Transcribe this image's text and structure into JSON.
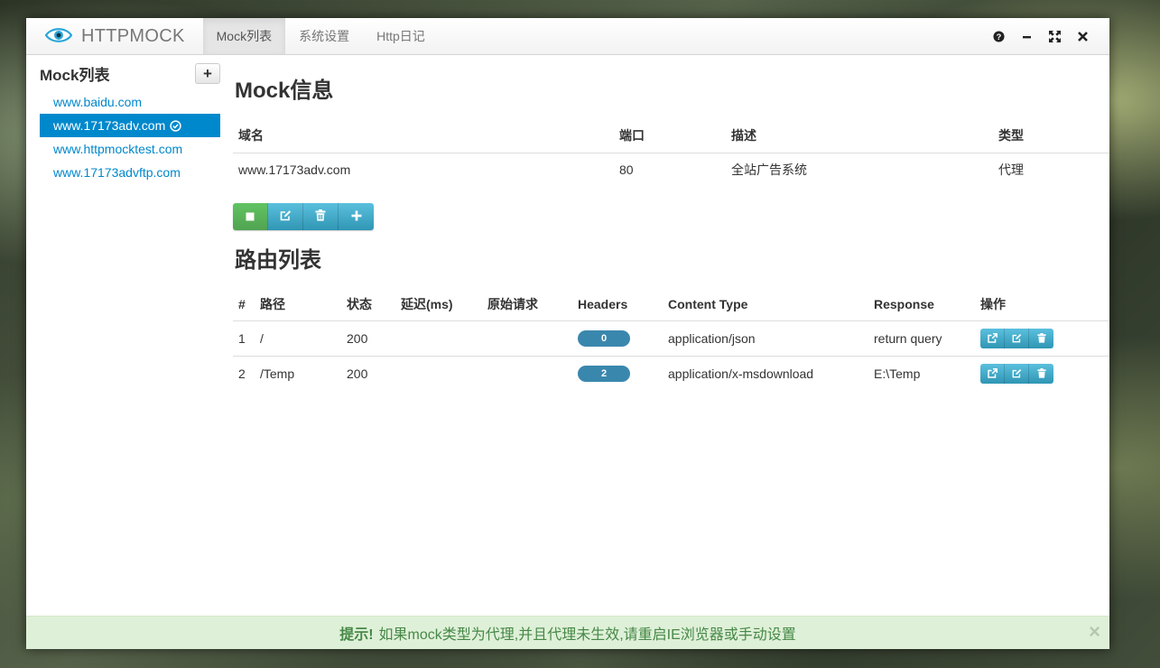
{
  "app": {
    "title": "HTTPMOCK",
    "tabs": [
      "Mock列表",
      "系统设置",
      "Http日记"
    ]
  },
  "sidebar": {
    "title": "Mock列表",
    "add_label": "+",
    "items": [
      {
        "label": "www.baidu.com",
        "active": false
      },
      {
        "label": "www.17173adv.com",
        "active": true
      },
      {
        "label": "www.httpmocktest.com",
        "active": false
      },
      {
        "label": "www.17173advftp.com",
        "active": false
      }
    ]
  },
  "mock_info": {
    "title": "Mock信息",
    "headers": [
      "域名",
      "端口",
      "描述",
      "类型"
    ],
    "row": [
      "www.17173adv.com",
      "80",
      "全站广告系统",
      "代理"
    ]
  },
  "routes": {
    "title": "路由列表",
    "headers": [
      "#",
      "路径",
      "状态",
      "延迟(ms)",
      "原始请求",
      "Headers",
      "Content Type",
      "Response",
      "操作"
    ],
    "rows": [
      {
        "num": "1",
        "path": "/",
        "status": "200",
        "delay": "",
        "raw": "",
        "headers": "0",
        "content_type": "application/json",
        "response": "return query"
      },
      {
        "num": "2",
        "path": "/Temp",
        "status": "200",
        "delay": "",
        "raw": "",
        "headers": "2",
        "content_type": "application/x-msdownload",
        "response": "E:\\Temp"
      }
    ]
  },
  "alert": {
    "strong": "提示!",
    "message": "如果mock类型为代理,并且代理未生效,请重启IE浏览器或手动设置",
    "close": "×"
  },
  "colors": {
    "link": "#0088cc",
    "active_bg": "#0088cc",
    "success_btn": "#51a351",
    "info_btn": "#2f96b4",
    "badge": "#3a87ad",
    "alert_bg": "#dff0d8",
    "alert_text": "#468847"
  },
  "icons": [
    "eye-icon",
    "help-icon",
    "minimize-icon",
    "fullscreen-icon",
    "close-icon",
    "check-circle-icon",
    "stop-icon",
    "edit-icon",
    "trash-icon",
    "plus-icon",
    "share-icon"
  ]
}
